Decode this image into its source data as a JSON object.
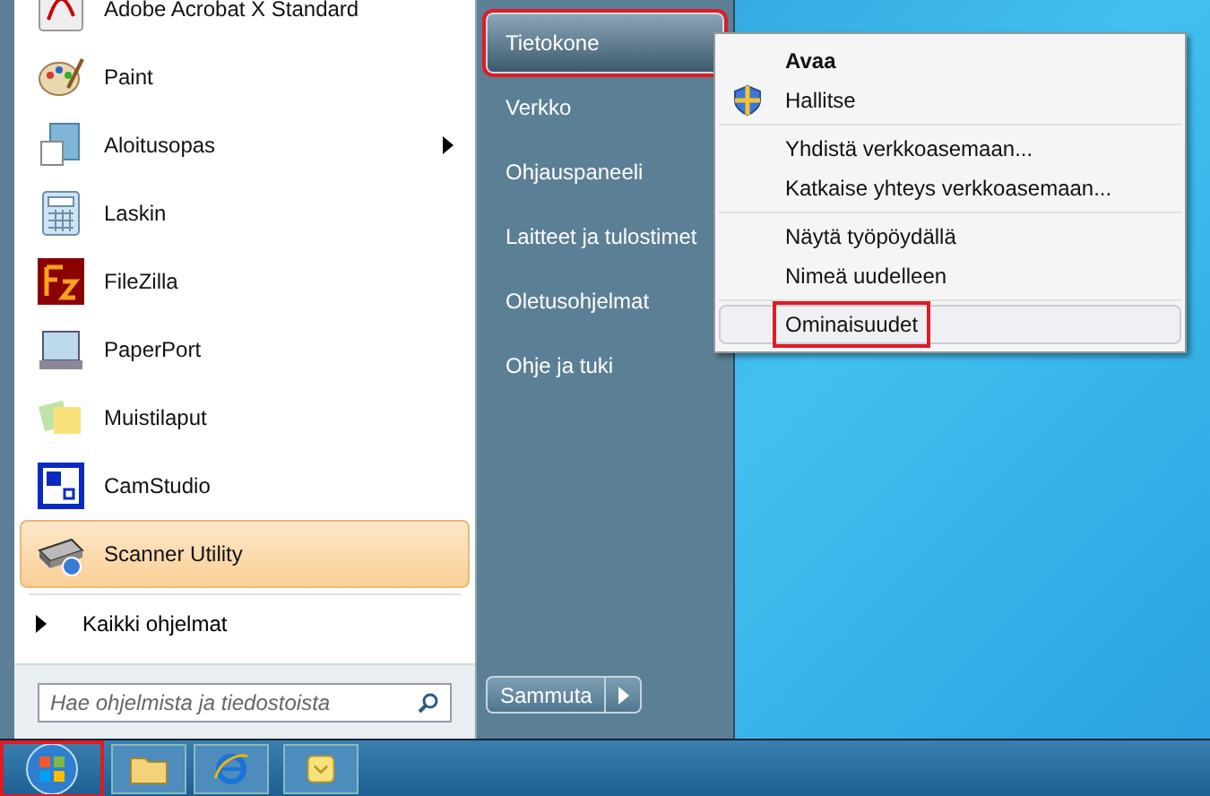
{
  "programs": [
    {
      "label": "Adobe Acrobat X Standard",
      "selected": false,
      "submenu": false
    },
    {
      "label": "Paint",
      "selected": false,
      "submenu": false
    },
    {
      "label": "Aloitusopas",
      "selected": false,
      "submenu": true
    },
    {
      "label": "Laskin",
      "selected": false,
      "submenu": false
    },
    {
      "label": "FileZilla",
      "selected": false,
      "submenu": false
    },
    {
      "label": "PaperPort",
      "selected": false,
      "submenu": false
    },
    {
      "label": "Muistilaput",
      "selected": false,
      "submenu": false
    },
    {
      "label": "CamStudio",
      "selected": false,
      "submenu": false
    },
    {
      "label": "Scanner Utility",
      "selected": true,
      "submenu": false
    }
  ],
  "all_programs": {
    "label": "Kaikki ohjelmat"
  },
  "search": {
    "placeholder": "Hae ohjelmista ja tiedostoista"
  },
  "places": [
    {
      "label": "Tietokone",
      "selected": true,
      "highlighted": true
    },
    {
      "label": "Verkko",
      "selected": false,
      "highlighted": false
    },
    {
      "label": "Ohjauspaneeli",
      "selected": false,
      "highlighted": false
    },
    {
      "label": "Laitteet ja tulostimet",
      "selected": false,
      "highlighted": false
    },
    {
      "label": "Oletusohjelmat",
      "selected": false,
      "highlighted": false
    },
    {
      "label": "Ohje ja tuki",
      "selected": false,
      "highlighted": false
    }
  ],
  "shutdown": {
    "label": "Sammuta"
  },
  "context_menu": [
    [
      {
        "label": "Avaa",
        "default": true,
        "shield": false,
        "selected": false,
        "highlighted": false
      },
      {
        "label": "Hallitse",
        "default": false,
        "shield": true,
        "selected": false,
        "highlighted": false
      }
    ],
    [
      {
        "label": "Yhdistä verkkoasemaan...",
        "default": false,
        "shield": false,
        "selected": false,
        "highlighted": false
      },
      {
        "label": "Katkaise yhteys verkkoasemaan...",
        "default": false,
        "shield": false,
        "selected": false,
        "highlighted": false
      }
    ],
    [
      {
        "label": "Näytä työpöydällä",
        "default": false,
        "shield": false,
        "selected": false,
        "highlighted": false
      },
      {
        "label": "Nimeä uudelleen",
        "default": false,
        "shield": false,
        "selected": false,
        "highlighted": false
      }
    ],
    [
      {
        "label": "Ominaisuudet",
        "default": false,
        "shield": false,
        "selected": true,
        "highlighted": true
      }
    ]
  ],
  "taskbar": {
    "start_highlighted": true
  }
}
